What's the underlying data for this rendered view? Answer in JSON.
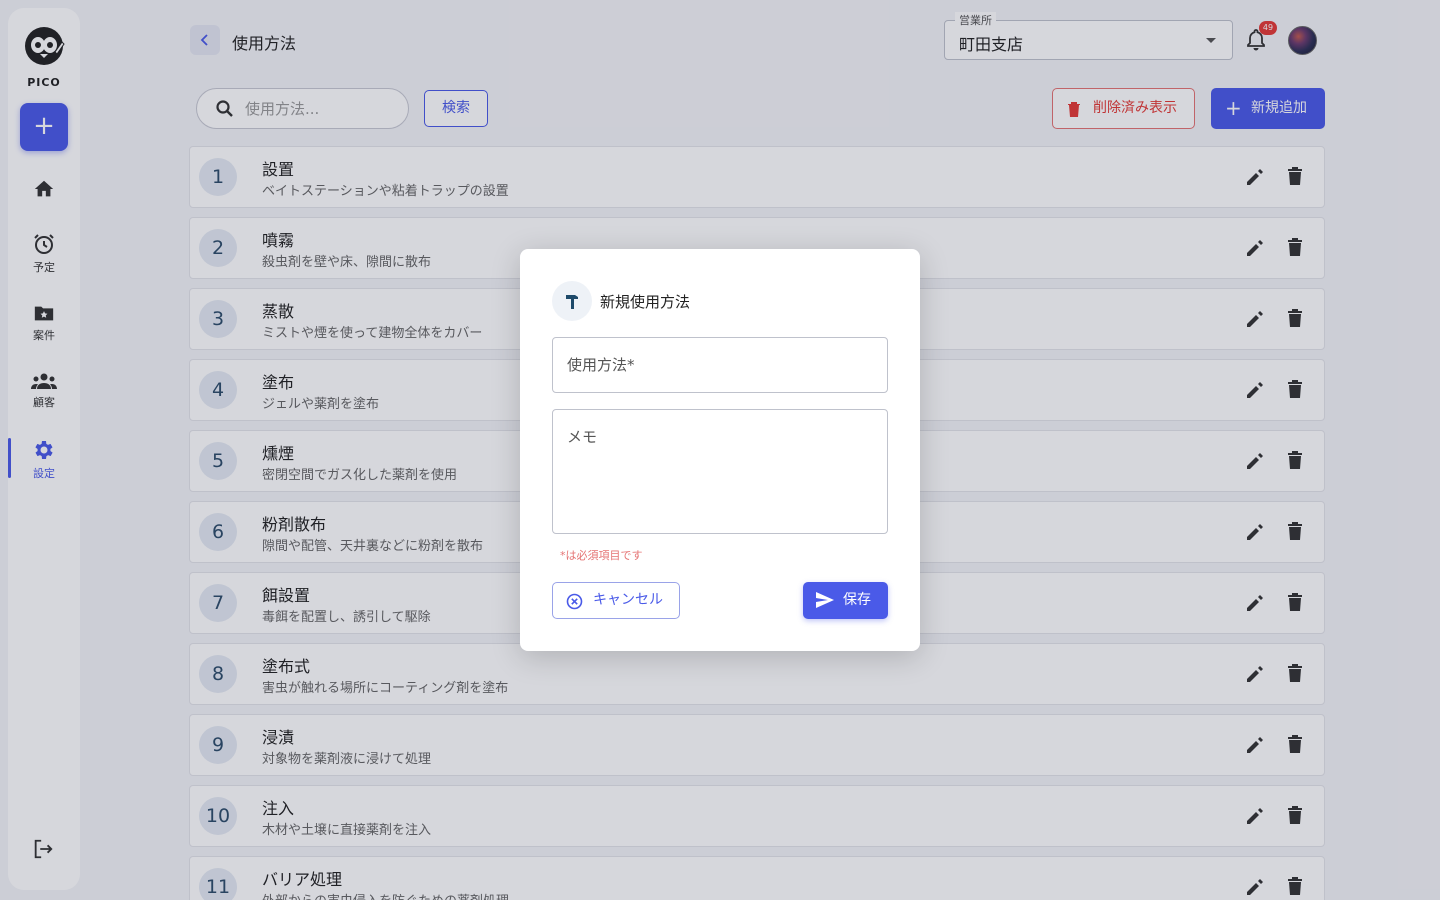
{
  "sidebar": {
    "logo_text": "PICO",
    "add_label": "+",
    "items": [
      {
        "name": "home",
        "label": ""
      },
      {
        "name": "schedule",
        "label": "予定"
      },
      {
        "name": "cases",
        "label": "案件"
      },
      {
        "name": "customers",
        "label": "顧客"
      },
      {
        "name": "settings",
        "label": "設定"
      }
    ]
  },
  "header": {
    "title": "使用方法",
    "branch_label": "営業所",
    "branch_value": "町田支店",
    "notification_count": "49"
  },
  "toolbar": {
    "search_placeholder": "使用方法...",
    "search_button": "検索",
    "deleted_button": "削除済み表示",
    "new_button": "新規追加"
  },
  "rows": [
    {
      "num": "1",
      "title": "設置",
      "desc": "ベイトステーションや粘着トラップの設置"
    },
    {
      "num": "2",
      "title": "噴霧",
      "desc": "殺虫剤を壁や床、隙間に散布"
    },
    {
      "num": "3",
      "title": "蒸散",
      "desc": "ミストや煙を使って建物全体をカバー"
    },
    {
      "num": "4",
      "title": "塗布",
      "desc": "ジェルや薬剤を塗布"
    },
    {
      "num": "5",
      "title": "燻煙",
      "desc": "密閉空間でガス化した薬剤を使用"
    },
    {
      "num": "6",
      "title": "粉剤散布",
      "desc": "隙間や配管、天井裏などに粉剤を散布"
    },
    {
      "num": "7",
      "title": "餌設置",
      "desc": "毒餌を配置し、誘引して駆除"
    },
    {
      "num": "8",
      "title": "塗布式",
      "desc": "害虫が触れる場所にコーティング剤を塗布"
    },
    {
      "num": "9",
      "title": "浸漬",
      "desc": "対象物を薬剤液に浸けて処理"
    },
    {
      "num": "10",
      "title": "注入",
      "desc": "木材や土壌に直接薬剤を注入"
    },
    {
      "num": "11",
      "title": "バリア処理",
      "desc": "外部からの害虫侵入を防ぐための薬剤処理"
    }
  ],
  "modal": {
    "title": "新規使用方法",
    "name_placeholder": "使用方法*",
    "memo_placeholder": "メモ",
    "required_note": "*は必須項目です",
    "cancel_label": "キャンセル",
    "save_label": "保存"
  },
  "colors": {
    "accent": "#4a5ae8",
    "danger": "#e53935"
  }
}
